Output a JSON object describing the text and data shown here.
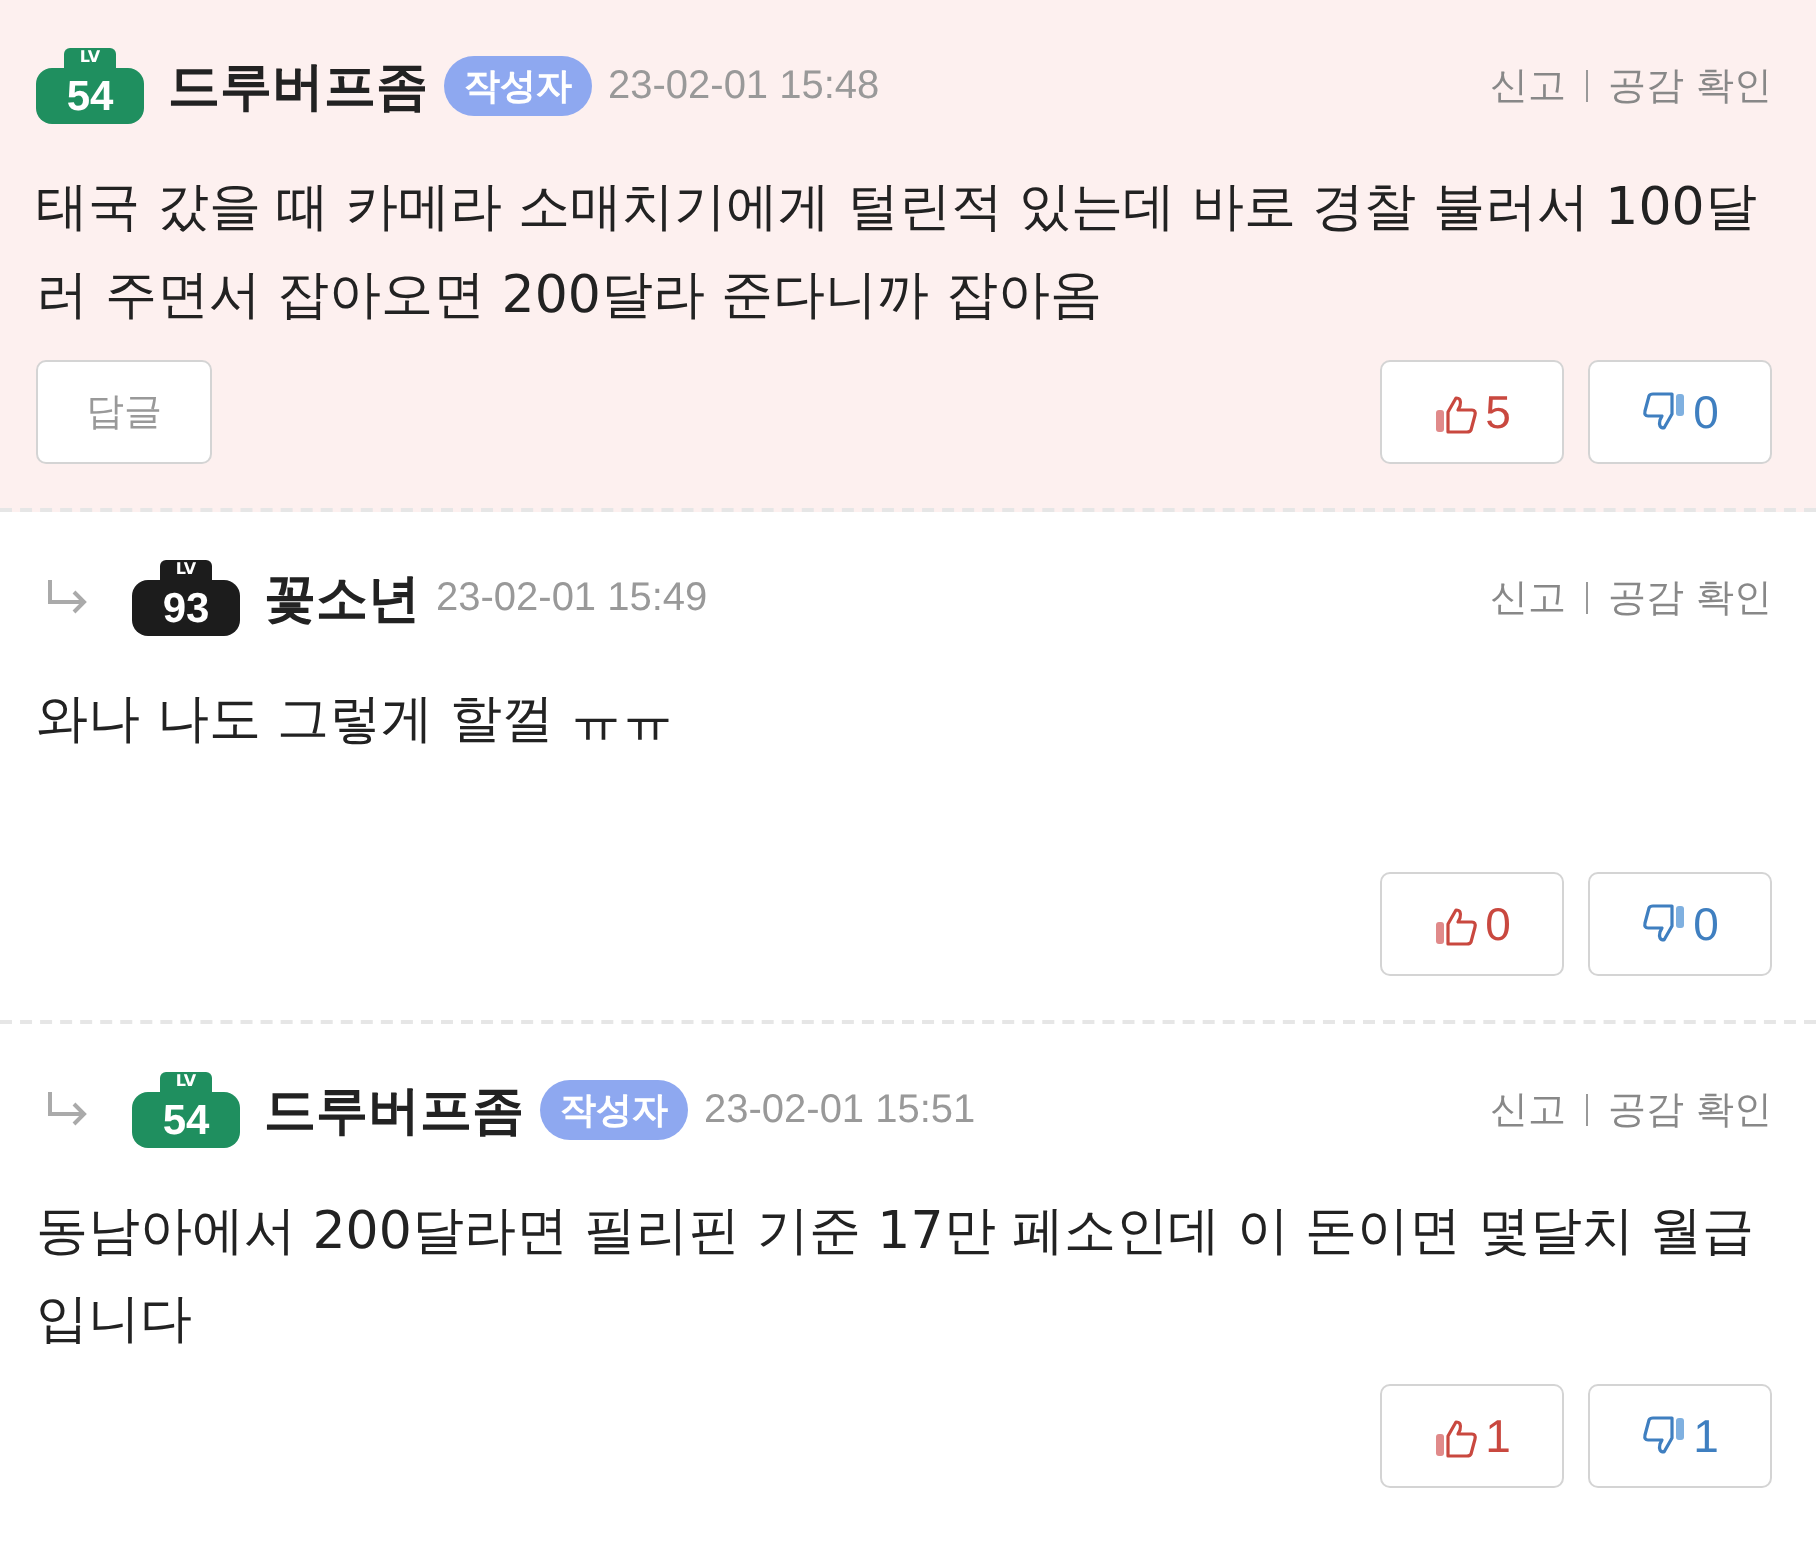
{
  "comments": [
    {
      "highlighted": true,
      "reply": false,
      "badge": {
        "label": "LV",
        "level": "54",
        "color": "#1f8f5f"
      },
      "author": "드루버프좀",
      "author_tag": "작성자",
      "date": "23-02-01 15:48",
      "report": "신고",
      "empathy": "공감 확인",
      "text": "태국 갔을 때 카메라 소매치기에게 털린적 있는데 바로 경찰 불러서 100달러 주면서 잡아오면 200달라 준다니까 잡아옴",
      "reply_button": "답글",
      "likes": "5",
      "dislikes": "0"
    },
    {
      "highlighted": false,
      "reply": true,
      "badge": {
        "label": "LV",
        "level": "93",
        "color": "#1c1c1c"
      },
      "author": "꽃소년",
      "date": "23-02-01 15:49",
      "report": "신고",
      "empathy": "공감 확인",
      "text": "와나 나도 그렇게 할껄 ㅠㅠ",
      "likes": "0",
      "dislikes": "0"
    },
    {
      "highlighted": false,
      "reply": true,
      "badge": {
        "label": "LV",
        "level": "54",
        "color": "#1f8f5f"
      },
      "author": "드루버프좀",
      "author_tag": "작성자",
      "date": "23-02-01 15:51",
      "report": "신고",
      "empathy": "공감 확인",
      "text": "동남아에서 200달라면 필리핀 기준 17만 페소인데 이 돈이면 몇달치 월급입니다",
      "likes": "1",
      "dislikes": "1"
    }
  ]
}
